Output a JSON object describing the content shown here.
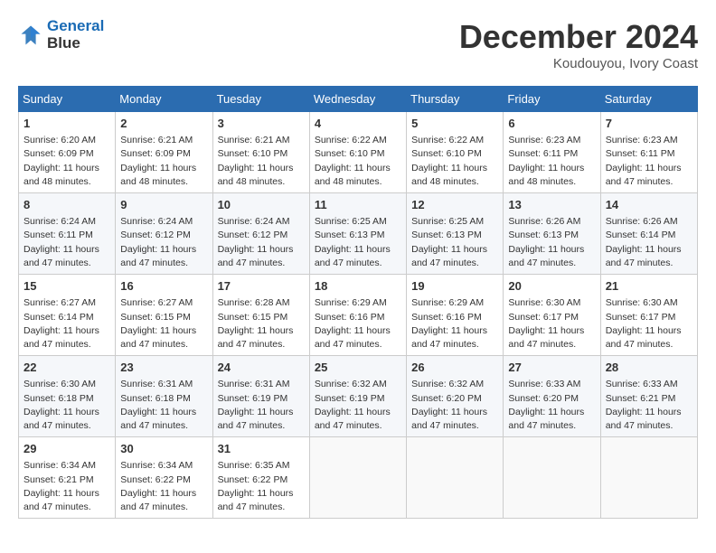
{
  "header": {
    "logo_line1": "General",
    "logo_line2": "Blue",
    "month": "December 2024",
    "location": "Koudouyou, Ivory Coast"
  },
  "weekdays": [
    "Sunday",
    "Monday",
    "Tuesday",
    "Wednesday",
    "Thursday",
    "Friday",
    "Saturday"
  ],
  "weeks": [
    [
      {
        "day": "1",
        "info": "Sunrise: 6:20 AM\nSunset: 6:09 PM\nDaylight: 11 hours\nand 48 minutes."
      },
      {
        "day": "2",
        "info": "Sunrise: 6:21 AM\nSunset: 6:09 PM\nDaylight: 11 hours\nand 48 minutes."
      },
      {
        "day": "3",
        "info": "Sunrise: 6:21 AM\nSunset: 6:10 PM\nDaylight: 11 hours\nand 48 minutes."
      },
      {
        "day": "4",
        "info": "Sunrise: 6:22 AM\nSunset: 6:10 PM\nDaylight: 11 hours\nand 48 minutes."
      },
      {
        "day": "5",
        "info": "Sunrise: 6:22 AM\nSunset: 6:10 PM\nDaylight: 11 hours\nand 48 minutes."
      },
      {
        "day": "6",
        "info": "Sunrise: 6:23 AM\nSunset: 6:11 PM\nDaylight: 11 hours\nand 48 minutes."
      },
      {
        "day": "7",
        "info": "Sunrise: 6:23 AM\nSunset: 6:11 PM\nDaylight: 11 hours\nand 47 minutes."
      }
    ],
    [
      {
        "day": "8",
        "info": "Sunrise: 6:24 AM\nSunset: 6:11 PM\nDaylight: 11 hours\nand 47 minutes."
      },
      {
        "day": "9",
        "info": "Sunrise: 6:24 AM\nSunset: 6:12 PM\nDaylight: 11 hours\nand 47 minutes."
      },
      {
        "day": "10",
        "info": "Sunrise: 6:24 AM\nSunset: 6:12 PM\nDaylight: 11 hours\nand 47 minutes."
      },
      {
        "day": "11",
        "info": "Sunrise: 6:25 AM\nSunset: 6:13 PM\nDaylight: 11 hours\nand 47 minutes."
      },
      {
        "day": "12",
        "info": "Sunrise: 6:25 AM\nSunset: 6:13 PM\nDaylight: 11 hours\nand 47 minutes."
      },
      {
        "day": "13",
        "info": "Sunrise: 6:26 AM\nSunset: 6:13 PM\nDaylight: 11 hours\nand 47 minutes."
      },
      {
        "day": "14",
        "info": "Sunrise: 6:26 AM\nSunset: 6:14 PM\nDaylight: 11 hours\nand 47 minutes."
      }
    ],
    [
      {
        "day": "15",
        "info": "Sunrise: 6:27 AM\nSunset: 6:14 PM\nDaylight: 11 hours\nand 47 minutes."
      },
      {
        "day": "16",
        "info": "Sunrise: 6:27 AM\nSunset: 6:15 PM\nDaylight: 11 hours\nand 47 minutes."
      },
      {
        "day": "17",
        "info": "Sunrise: 6:28 AM\nSunset: 6:15 PM\nDaylight: 11 hours\nand 47 minutes."
      },
      {
        "day": "18",
        "info": "Sunrise: 6:29 AM\nSunset: 6:16 PM\nDaylight: 11 hours\nand 47 minutes."
      },
      {
        "day": "19",
        "info": "Sunrise: 6:29 AM\nSunset: 6:16 PM\nDaylight: 11 hours\nand 47 minutes."
      },
      {
        "day": "20",
        "info": "Sunrise: 6:30 AM\nSunset: 6:17 PM\nDaylight: 11 hours\nand 47 minutes."
      },
      {
        "day": "21",
        "info": "Sunrise: 6:30 AM\nSunset: 6:17 PM\nDaylight: 11 hours\nand 47 minutes."
      }
    ],
    [
      {
        "day": "22",
        "info": "Sunrise: 6:30 AM\nSunset: 6:18 PM\nDaylight: 11 hours\nand 47 minutes."
      },
      {
        "day": "23",
        "info": "Sunrise: 6:31 AM\nSunset: 6:18 PM\nDaylight: 11 hours\nand 47 minutes."
      },
      {
        "day": "24",
        "info": "Sunrise: 6:31 AM\nSunset: 6:19 PM\nDaylight: 11 hours\nand 47 minutes."
      },
      {
        "day": "25",
        "info": "Sunrise: 6:32 AM\nSunset: 6:19 PM\nDaylight: 11 hours\nand 47 minutes."
      },
      {
        "day": "26",
        "info": "Sunrise: 6:32 AM\nSunset: 6:20 PM\nDaylight: 11 hours\nand 47 minutes."
      },
      {
        "day": "27",
        "info": "Sunrise: 6:33 AM\nSunset: 6:20 PM\nDaylight: 11 hours\nand 47 minutes."
      },
      {
        "day": "28",
        "info": "Sunrise: 6:33 AM\nSunset: 6:21 PM\nDaylight: 11 hours\nand 47 minutes."
      }
    ],
    [
      {
        "day": "29",
        "info": "Sunrise: 6:34 AM\nSunset: 6:21 PM\nDaylight: 11 hours\nand 47 minutes."
      },
      {
        "day": "30",
        "info": "Sunrise: 6:34 AM\nSunset: 6:22 PM\nDaylight: 11 hours\nand 47 minutes."
      },
      {
        "day": "31",
        "info": "Sunrise: 6:35 AM\nSunset: 6:22 PM\nDaylight: 11 hours\nand 47 minutes."
      },
      {
        "day": "",
        "info": ""
      },
      {
        "day": "",
        "info": ""
      },
      {
        "day": "",
        "info": ""
      },
      {
        "day": "",
        "info": ""
      }
    ]
  ]
}
